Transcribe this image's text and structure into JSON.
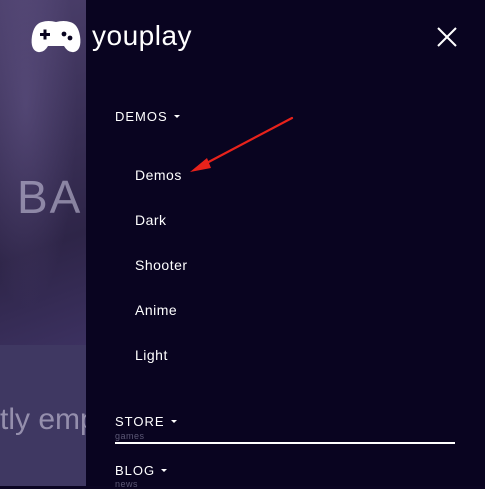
{
  "brand": {
    "name": "youplay",
    "icon": "gamepad-icon"
  },
  "background": {
    "hero_text": "BA",
    "sub_text": "tly emp"
  },
  "close_icon": "close-icon",
  "menu": {
    "demos": {
      "label": "DEMOS",
      "items": [
        {
          "label": "Demos"
        },
        {
          "label": "Dark"
        },
        {
          "label": "Shooter"
        },
        {
          "label": "Anime"
        },
        {
          "label": "Light"
        }
      ]
    },
    "store": {
      "label": "STORE",
      "sub": "games"
    },
    "blog": {
      "label": "BLOG",
      "sub": "news"
    }
  },
  "annotation": {
    "arrow_color": "#e8221b"
  }
}
